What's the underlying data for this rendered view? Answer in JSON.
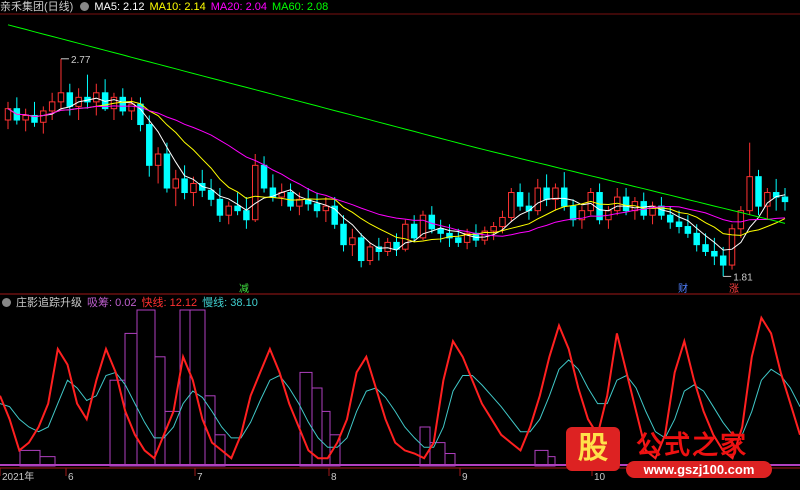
{
  "header": {
    "stock": "亲禾集团(日线)",
    "ma5": "MA5: 2.12",
    "ma10": "MA10: 2.14",
    "ma20": "MA20: 2.04",
    "ma60": "MA60: 2.08"
  },
  "indicator": {
    "name": "庄影追踪升级",
    "absorb": "吸筹: 0.02",
    "fast": "快线: 12.12",
    "slow": "慢线: 38.10"
  },
  "annotations": {
    "high": "2.77",
    "low": "1.81",
    "m1": "减",
    "m2": "财",
    "m3": "涨"
  },
  "xaxis": [
    "2021年",
    "6",
    "7",
    "8",
    "9",
    "10"
  ],
  "watermark": {
    "badge": "股",
    "name": "公式之家",
    "url": "www.gszj100.com"
  },
  "colors": {
    "up": "#ff3232",
    "down": "#00ffff",
    "ma5": "#ffffff",
    "ma10": "#ffff00",
    "ma20": "#ff00ff",
    "ma60": "#00ff00",
    "fast": "#ff2020",
    "slow": "#40c8c8",
    "bars": "#b040c0"
  },
  "chart_data": {
    "type": "candlestick",
    "price_range": [
      1.75,
      2.95
    ],
    "ohlc": [
      [
        2.5,
        2.58,
        2.46,
        2.55
      ],
      [
        2.55,
        2.6,
        2.48,
        2.5
      ],
      [
        2.5,
        2.55,
        2.45,
        2.52
      ],
      [
        2.52,
        2.58,
        2.47,
        2.49
      ],
      [
        2.49,
        2.56,
        2.44,
        2.54
      ],
      [
        2.54,
        2.62,
        2.5,
        2.58
      ],
      [
        2.58,
        2.77,
        2.55,
        2.62
      ],
      [
        2.62,
        2.66,
        2.52,
        2.56
      ],
      [
        2.56,
        2.64,
        2.5,
        2.6
      ],
      [
        2.6,
        2.7,
        2.55,
        2.58
      ],
      [
        2.58,
        2.66,
        2.52,
        2.62
      ],
      [
        2.62,
        2.68,
        2.54,
        2.55
      ],
      [
        2.55,
        2.62,
        2.5,
        2.6
      ],
      [
        2.6,
        2.64,
        2.52,
        2.54
      ],
      [
        2.54,
        2.6,
        2.5,
        2.57
      ],
      [
        2.57,
        2.6,
        2.45,
        2.48
      ],
      [
        2.48,
        2.52,
        2.25,
        2.3
      ],
      [
        2.3,
        2.38,
        2.22,
        2.35
      ],
      [
        2.35,
        2.4,
        2.18,
        2.2
      ],
      [
        2.2,
        2.28,
        2.12,
        2.24
      ],
      [
        2.24,
        2.3,
        2.15,
        2.18
      ],
      [
        2.18,
        2.25,
        2.12,
        2.22
      ],
      [
        2.22,
        2.28,
        2.16,
        2.19
      ],
      [
        2.19,
        2.24,
        2.12,
        2.15
      ],
      [
        2.15,
        2.2,
        2.05,
        2.08
      ],
      [
        2.08,
        2.14,
        2.04,
        2.12
      ],
      [
        2.12,
        2.18,
        2.08,
        2.1
      ],
      [
        2.1,
        2.16,
        2.02,
        2.06
      ],
      [
        2.06,
        2.35,
        2.05,
        2.3
      ],
      [
        2.3,
        2.34,
        2.18,
        2.2
      ],
      [
        2.2,
        2.26,
        2.14,
        2.16
      ],
      [
        2.16,
        2.22,
        2.12,
        2.18
      ],
      [
        2.18,
        2.22,
        2.1,
        2.12
      ],
      [
        2.12,
        2.18,
        2.08,
        2.15
      ],
      [
        2.15,
        2.2,
        2.1,
        2.13
      ],
      [
        2.13,
        2.18,
        2.07,
        2.1
      ],
      [
        2.1,
        2.16,
        2.05,
        2.12
      ],
      [
        2.12,
        2.16,
        2.02,
        2.04
      ],
      [
        2.04,
        2.08,
        1.92,
        1.95
      ],
      [
        1.95,
        2.02,
        1.9,
        1.98
      ],
      [
        1.98,
        2.0,
        1.85,
        1.88
      ],
      [
        1.88,
        1.96,
        1.86,
        1.94
      ],
      [
        1.94,
        1.98,
        1.88,
        1.92
      ],
      [
        1.92,
        1.98,
        1.9,
        1.96
      ],
      [
        1.96,
        2.0,
        1.9,
        1.93
      ],
      [
        1.93,
        2.06,
        1.92,
        2.04
      ],
      [
        2.04,
        2.08,
        1.96,
        1.98
      ],
      [
        1.98,
        2.1,
        1.97,
        2.08
      ],
      [
        2.08,
        2.12,
        2.0,
        2.02
      ],
      [
        2.02,
        2.06,
        1.96,
        2.0
      ],
      [
        2.0,
        2.04,
        1.94,
        1.98
      ],
      [
        1.98,
        2.02,
        1.94,
        1.96
      ],
      [
        1.96,
        2.02,
        1.93,
        2.0
      ],
      [
        2.0,
        2.04,
        1.94,
        1.97
      ],
      [
        1.97,
        2.03,
        1.95,
        2.01
      ],
      [
        2.01,
        2.05,
        1.97,
        2.03
      ],
      [
        2.03,
        2.1,
        2.0,
        2.07
      ],
      [
        2.07,
        2.2,
        2.05,
        2.18
      ],
      [
        2.18,
        2.22,
        2.1,
        2.12
      ],
      [
        2.12,
        2.18,
        2.06,
        2.1
      ],
      [
        2.1,
        2.24,
        2.08,
        2.2
      ],
      [
        2.2,
        2.26,
        2.12,
        2.15
      ],
      [
        2.15,
        2.22,
        2.1,
        2.2
      ],
      [
        2.2,
        2.27,
        2.1,
        2.12
      ],
      [
        2.12,
        2.15,
        2.03,
        2.06
      ],
      [
        2.06,
        2.12,
        2.02,
        2.1
      ],
      [
        2.1,
        2.2,
        2.08,
        2.18
      ],
      [
        2.18,
        2.22,
        2.04,
        2.06
      ],
      [
        2.06,
        2.12,
        2.02,
        2.1
      ],
      [
        2.1,
        2.2,
        2.08,
        2.16
      ],
      [
        2.16,
        2.2,
        2.08,
        2.1
      ],
      [
        2.1,
        2.16,
        2.06,
        2.14
      ],
      [
        2.14,
        2.18,
        2.06,
        2.08
      ],
      [
        2.08,
        2.14,
        2.04,
        2.12
      ],
      [
        2.12,
        2.16,
        2.06,
        2.08
      ],
      [
        2.08,
        2.12,
        2.02,
        2.05
      ],
      [
        2.05,
        2.1,
        2.0,
        2.03
      ],
      [
        2.03,
        2.08,
        1.98,
        2.0
      ],
      [
        2.0,
        2.04,
        1.92,
        1.95
      ],
      [
        1.95,
        2.0,
        1.9,
        1.92
      ],
      [
        1.92,
        1.98,
        1.86,
        1.9
      ],
      [
        1.9,
        1.94,
        1.81,
        1.86
      ],
      [
        1.86,
        2.04,
        1.84,
        2.02
      ],
      [
        2.02,
        2.12,
        1.98,
        2.1
      ],
      [
        2.1,
        2.4,
        2.08,
        2.25
      ],
      [
        2.25,
        2.28,
        2.08,
        2.12
      ],
      [
        2.12,
        2.2,
        2.06,
        2.18
      ],
      [
        2.18,
        2.24,
        2.1,
        2.16
      ],
      [
        2.16,
        2.2,
        2.1,
        2.14
      ]
    ]
  }
}
